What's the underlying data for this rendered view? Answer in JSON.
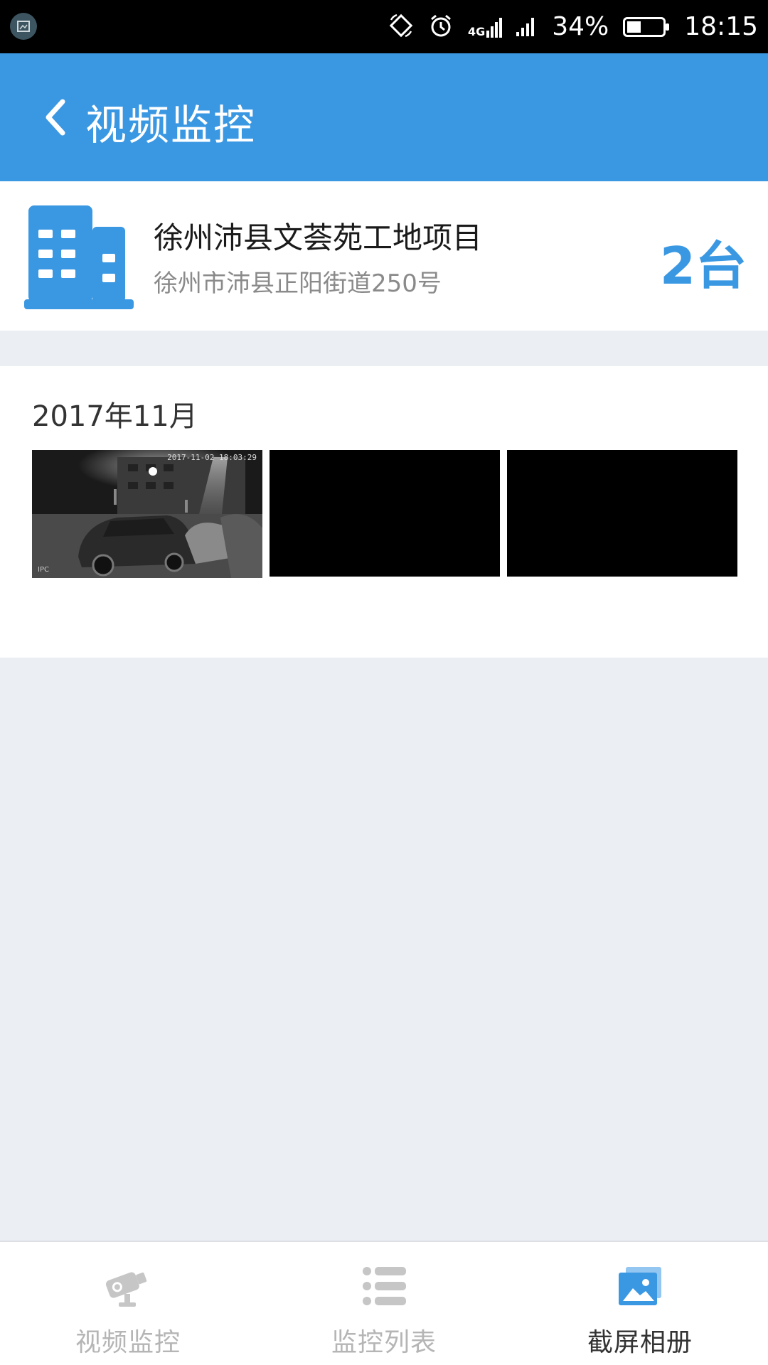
{
  "status_bar": {
    "battery": "34%",
    "battery_level": 0.34,
    "time": "18:15",
    "network": "4G",
    "icons": [
      "screenshot-icon",
      "rotate-icon",
      "alarm-icon",
      "network-4g-icon",
      "signal-icon",
      "battery-icon"
    ]
  },
  "header": {
    "title": "视频监控",
    "back_icon": "back-arrow-icon",
    "background": "#3a98e3"
  },
  "project": {
    "name": "徐州沛县文荟苑工地项目",
    "address": "徐州市沛县正阳街道250号",
    "device_count": "2台",
    "icon": "building-icon",
    "accent": "#3a98e3"
  },
  "album": {
    "month": "2017年11月",
    "thumbnails": [
      {
        "type": "night-camera-snapshot",
        "timestamp": "2017-11-02 18:03:29",
        "label": "IPC"
      },
      {
        "type": "black"
      },
      {
        "type": "black"
      }
    ]
  },
  "bottom_nav": {
    "items": [
      {
        "label": "视频监控",
        "icon": "camera-icon",
        "active": false
      },
      {
        "label": "监控列表",
        "icon": "list-icon",
        "active": false
      },
      {
        "label": "截屏相册",
        "icon": "album-icon",
        "active": true
      }
    ],
    "active_color": "#3a98e3",
    "inactive_color": "#c0c0c0"
  }
}
